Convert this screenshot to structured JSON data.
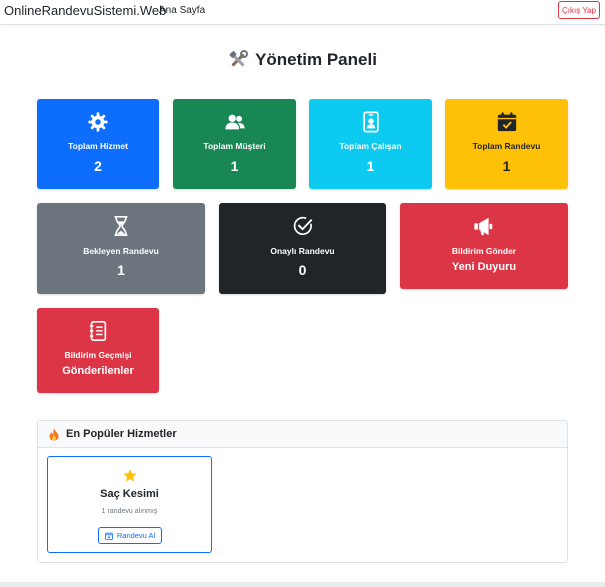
{
  "navbar": {
    "brand": "OnlineRandevuSistemi.Web",
    "home_link": "Ana Sayfa",
    "logout_label": "Çıkış Yap"
  },
  "page": {
    "title": "Yönetim Paneli",
    "title_icon": "tools-icon"
  },
  "stats": [
    {
      "label": "Toplam Hizmet",
      "value": "2",
      "icon": "gear-icon",
      "color": "#0d6efd"
    },
    {
      "label": "Toplam Müşteri",
      "value": "1",
      "icon": "users-icon",
      "color": "#198754"
    },
    {
      "label": "Toplam Çalışan",
      "value": "1",
      "icon": "badge-icon",
      "color": "#0dcaf0"
    },
    {
      "label": "Toplam Randevu",
      "value": "1",
      "icon": "calendar-check-icon",
      "color": "#ffc107"
    },
    {
      "label": "Bekleyen Randevu",
      "value": "1",
      "icon": "hourglass-icon",
      "color": "#6c757d"
    },
    {
      "label": "Onaylı Randevu",
      "value": "0",
      "icon": "check-circle-icon",
      "color": "#212529"
    }
  ],
  "actions": [
    {
      "label": "Bildirim Gönder",
      "text": "Yeni Duyuru",
      "icon": "megaphone-icon",
      "color": "#dc3545"
    },
    {
      "label": "Bildirim Geçmişi",
      "text": "Gönderilenler",
      "icon": "journal-icon",
      "color": "#dc3545"
    }
  ],
  "popular": {
    "title": "En Popüler Hizmetler",
    "icon": "fire-icon",
    "items": [
      {
        "name": "Saç Kesimi",
        "count": "1 randevu alınmış",
        "button": "Randevu Al",
        "icon": "star-icon"
      }
    ]
  }
}
